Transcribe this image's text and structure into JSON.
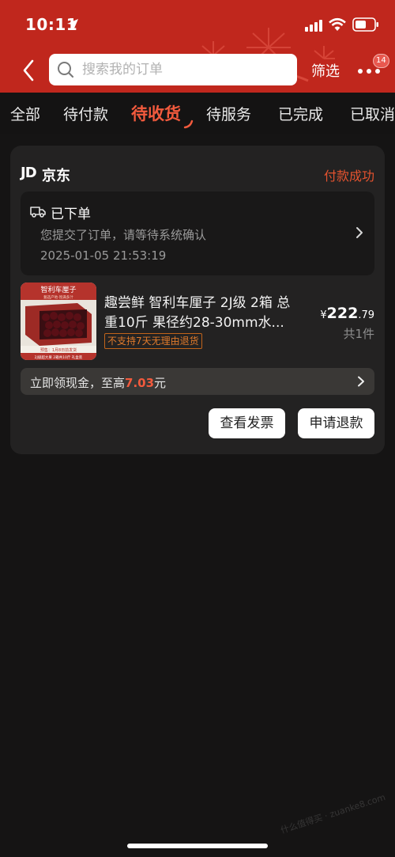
{
  "status_bar": {
    "time": "10:11"
  },
  "header": {
    "search_placeholder": "搜索我的订单",
    "filter_label": "筛选",
    "notification_count": "14"
  },
  "tabs": [
    {
      "label": "全部"
    },
    {
      "label": "待付款"
    },
    {
      "label": "待收货",
      "active": true
    },
    {
      "label": "待服务"
    },
    {
      "label": "已完成"
    },
    {
      "label": "已取消"
    }
  ],
  "order": {
    "shop_logo": "JD",
    "shop_name": "京东",
    "status": "付款成功",
    "progress": {
      "title": "已下单",
      "description": "您提交了订单，请等待系统确认",
      "time": "2025-01-05 21:53:19"
    },
    "product": {
      "title_line1": "趣尝鲜 智利车厘子 2J级 2箱 总",
      "title_line2": "重10斤  果径约28-30mm水...",
      "return_tag": "不支持7天无理由退货",
      "price_currency": "¥",
      "price_int": "222",
      "price_dec": ".79",
      "quantity": "共1件",
      "thumb_title": "智利车厘子",
      "thumb_subtitle": "甄选产地·饱满多汁",
      "thumb_banner1": "预售：1月8日前发货",
      "thumb_banner2": "2J级超大果 2箱共10斤 礼盒装"
    },
    "cashback": {
      "prefix": "立即领现金，至高",
      "amount": "7.03",
      "suffix": "元"
    },
    "actions": {
      "invoice_label": "查看发票",
      "refund_label": "申请退款"
    }
  },
  "watermark": "什么值得买 · zuanke8.com",
  "colors": {
    "header_red": "#c0271d",
    "accent": "#f25a3d",
    "background": "#151414",
    "card": "#232222"
  }
}
